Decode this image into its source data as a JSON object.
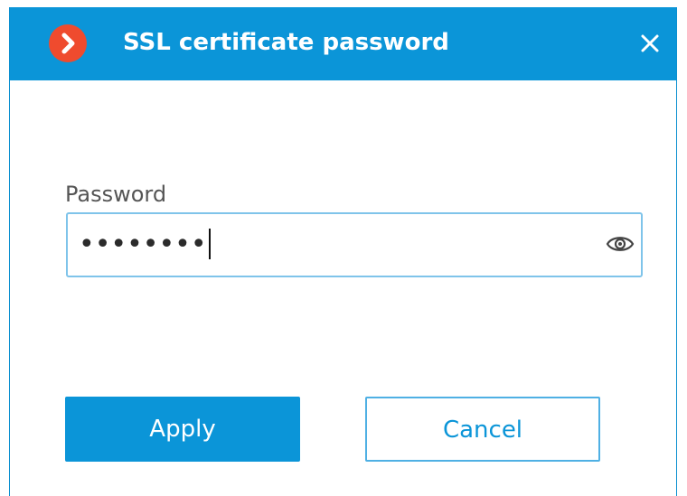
{
  "dialog": {
    "title": "SSL certificate password",
    "logo_icon": "app-logo-chevron-icon",
    "close_icon": "close-icon"
  },
  "password": {
    "label": "Password",
    "masked_value": "••••••••",
    "reveal_icon": "eye-icon"
  },
  "buttons": {
    "apply_label": "Apply",
    "cancel_label": "Cancel"
  },
  "colors": {
    "accent": "#0b95d8",
    "logo": "#ef4b2e",
    "field_border": "#7fc4ea"
  }
}
